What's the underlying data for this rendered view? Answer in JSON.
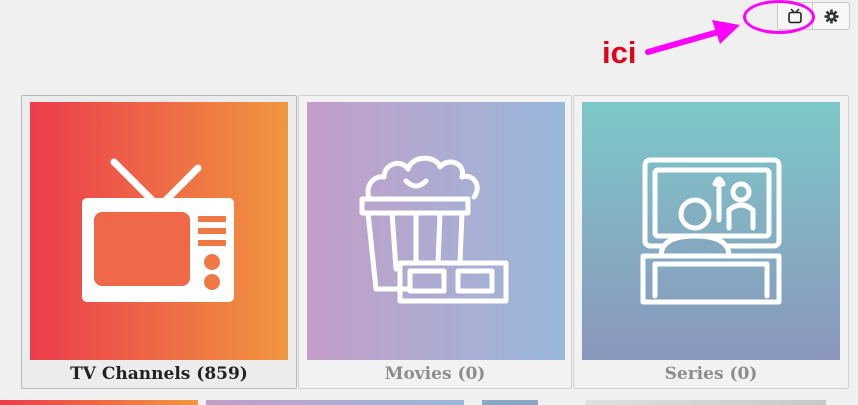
{
  "toolbar": {
    "tv_icon": "tv-icon",
    "gear_icon": "gear-icon"
  },
  "annotation": {
    "text": "ici",
    "color": "#e2001a",
    "marker_color": "#ff00ff"
  },
  "cards": [
    {
      "label": "TV Channels (859)",
      "icon": "tv-icon",
      "active": true
    },
    {
      "label": "Movies (0)",
      "icon": "popcorn-3d-glasses-icon",
      "active": false
    },
    {
      "label": "Series (0)",
      "icon": "viewer-watching-screen-icon",
      "active": false
    }
  ]
}
